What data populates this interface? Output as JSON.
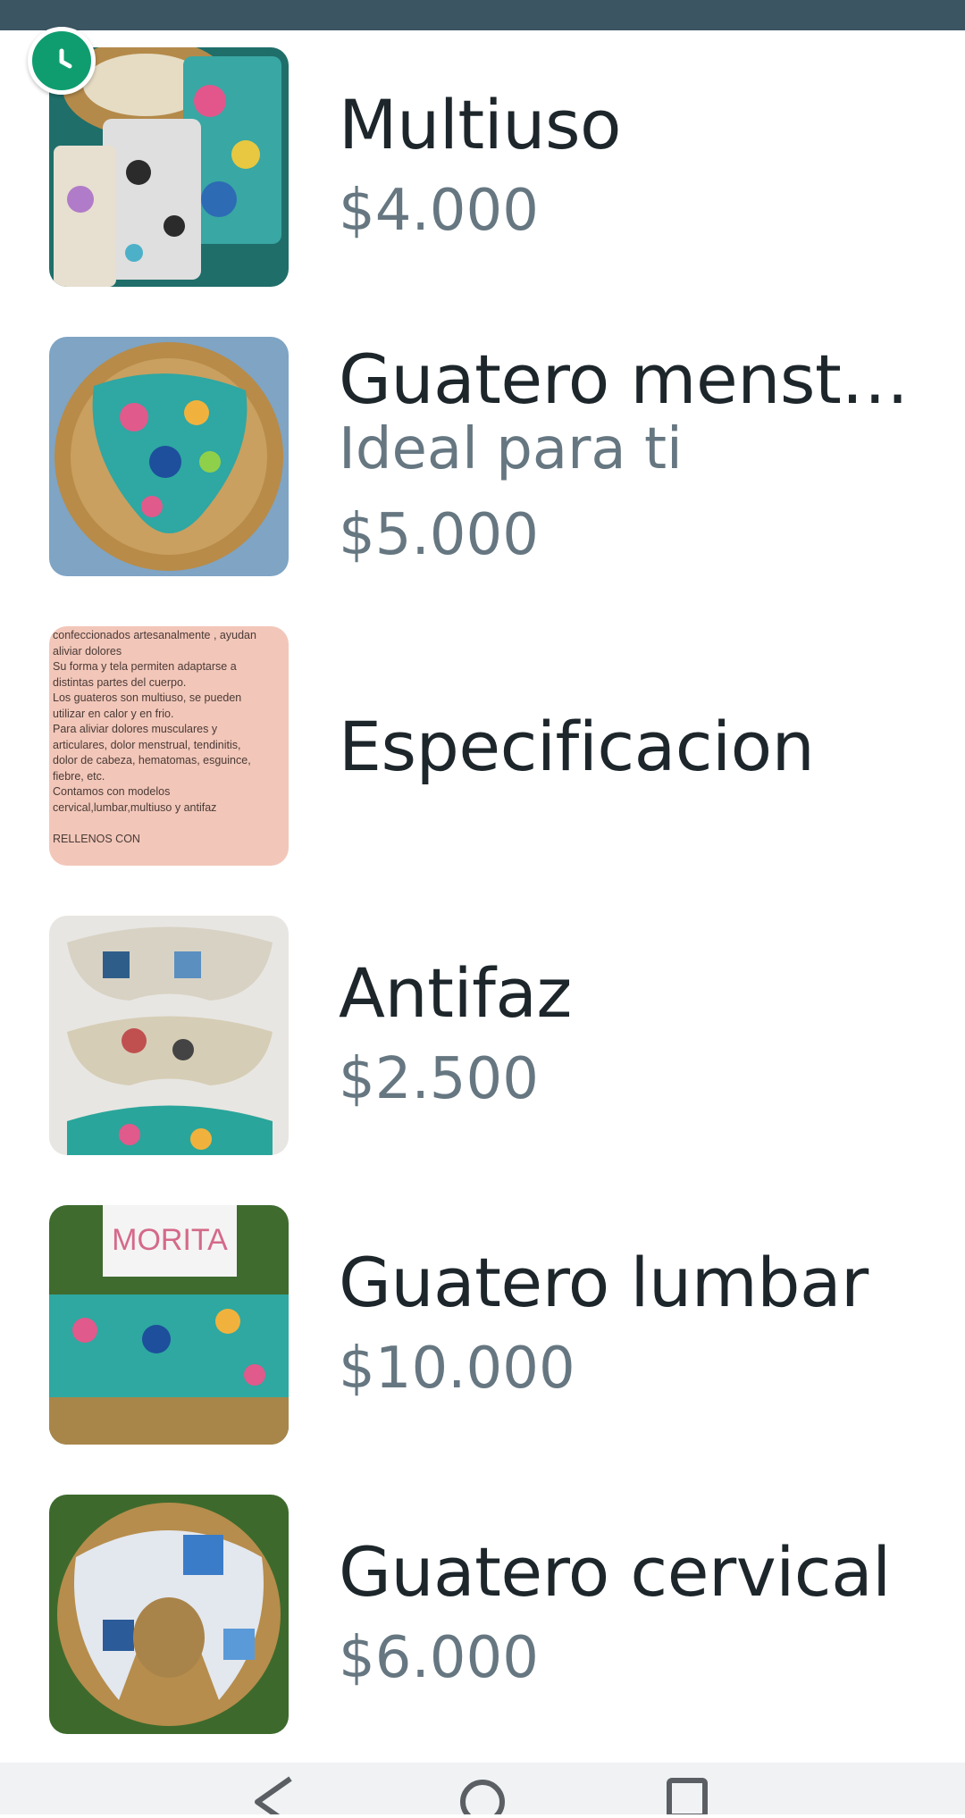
{
  "items": [
    {
      "title": "Multiuso",
      "desc": "",
      "price": "$4.000",
      "thumb": "multiuso"
    },
    {
      "title": "Guatero menstrual",
      "desc": "Ideal para ti",
      "price": "$5.000",
      "thumb": "menstrual"
    },
    {
      "title": "Especificacion",
      "desc": "",
      "price": "",
      "thumb": "spec"
    },
    {
      "title": "Antifaz",
      "desc": "",
      "price": "$2.500",
      "thumb": "antifaz"
    },
    {
      "title": "Guatero lumbar",
      "desc": "",
      "price": "$10.000",
      "thumb": "lumbar"
    },
    {
      "title": "Guatero cervical",
      "desc": "",
      "price": "$6.000",
      "thumb": "cervical"
    }
  ],
  "spec_image_text": "confeccionados artesanalmente , ayudan\naliviar dolores\nSu forma y tela permiten adaptarse a\ndistintas partes del cuerpo.\nLos guateros son multiuso, se pueden\nutilizar en calor y en frio.\nPara aliviar dolores musculares y\narticulares, dolor menstrual, tendinitis,\ndolor de cabeza, hematomas, esguince,\nfiebre, etc.\nContamos con modelos\ncervical,lumbar,multiuso y antifaz\n\nRELLENOS CON",
  "lumbar_sign_text": "MORITA",
  "icons": {
    "badge": "clock-icon",
    "nav": [
      "back-triangle-icon",
      "home-circle-icon",
      "recents-square-icon"
    ]
  },
  "colors": {
    "status_bar": "#3b5563",
    "badge": "#0f9d6f",
    "title": "#1d262b",
    "secondary": "#667781"
  }
}
